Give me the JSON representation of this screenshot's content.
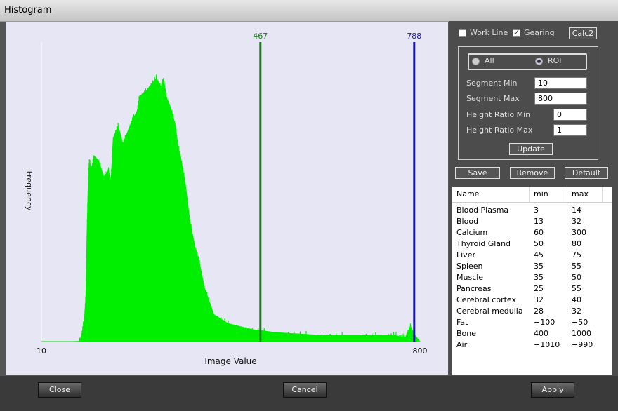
{
  "window": {
    "title": "Histogram"
  },
  "chart_data": {
    "type": "area",
    "xlabel": "Image Value",
    "ylabel": "Frequency",
    "xlim": [
      10,
      800
    ],
    "x_tick_labels": [
      "10",
      "800"
    ],
    "series_color": "#00ee00",
    "x": [
      10,
      75,
      90,
      95,
      100,
      103,
      105,
      108,
      110,
      115,
      120,
      130,
      140,
      150,
      155,
      160,
      170,
      180,
      190,
      200,
      210,
      215,
      225,
      235,
      250,
      260,
      265,
      270,
      280,
      290,
      295,
      300,
      310,
      320,
      330,
      340,
      350,
      370,
      400,
      450,
      500,
      550,
      600,
      650,
      700,
      730,
      750,
      760,
      770,
      780,
      790,
      800
    ],
    "values": [
      0,
      0,
      0.1,
      3,
      8,
      16,
      35,
      55,
      60,
      58,
      62,
      60,
      55,
      57,
      53,
      68,
      72,
      66,
      70,
      74,
      77,
      82,
      83,
      85,
      88,
      85,
      88,
      82,
      78,
      72,
      65,
      62,
      53,
      40,
      32,
      26,
      18,
      9,
      6,
      4,
      3,
      2.5,
      2,
      2,
      2,
      2,
      2,
      1.5,
      1.5,
      5,
      2,
      0
    ],
    "vertical_markers": [
      {
        "label": "467",
        "x": 467,
        "color": "#1b7a1b"
      },
      {
        "label": "788",
        "x": 788,
        "color": "#1a1aa0"
      }
    ]
  },
  "options": {
    "work_line_label": "Work Line",
    "work_line_checked": false,
    "gearing_label": "Gearing",
    "gearing_checked": true,
    "calc2_label": "Calc2"
  },
  "scope": {
    "all_label": "All",
    "roi_label": "ROI",
    "selected": "ROI"
  },
  "fields": {
    "segment_min_label": "Segment Min",
    "segment_min_value": "10",
    "segment_max_label": "Segment Max",
    "segment_max_value": "800",
    "height_ratio_min_label": "Height Ratio Min",
    "height_ratio_min_value": "0",
    "height_ratio_max_label": "Height Ratio Max",
    "height_ratio_max_value": "1",
    "update_label": "Update"
  },
  "actions": {
    "save_label": "Save",
    "remove_label": "Remove",
    "default_label": "Default"
  },
  "table": {
    "columns": [
      "Name",
      "min",
      "max"
    ],
    "rows": [
      [
        "Blood Plasma",
        "3",
        "14"
      ],
      [
        "Blood",
        "13",
        "32"
      ],
      [
        "Calcium",
        "60",
        "300"
      ],
      [
        "Thyroid Gland",
        "50",
        "80"
      ],
      [
        "Liver",
        "45",
        "75"
      ],
      [
        "Spleen",
        "35",
        "55"
      ],
      [
        "Muscle",
        "35",
        "50"
      ],
      [
        "Pancreas",
        "25",
        "55"
      ],
      [
        "Cerebral cortex",
        "32",
        "40"
      ],
      [
        "Cerebral medulla",
        "28",
        "32"
      ],
      [
        "Fat",
        "−100",
        "−50"
      ],
      [
        "Bone",
        "400",
        "1000"
      ],
      [
        "Air",
        "−1010",
        "−990"
      ]
    ]
  },
  "bottom": {
    "close_label": "Close",
    "cancel_label": "Cancel",
    "apply_label": "Apply"
  }
}
